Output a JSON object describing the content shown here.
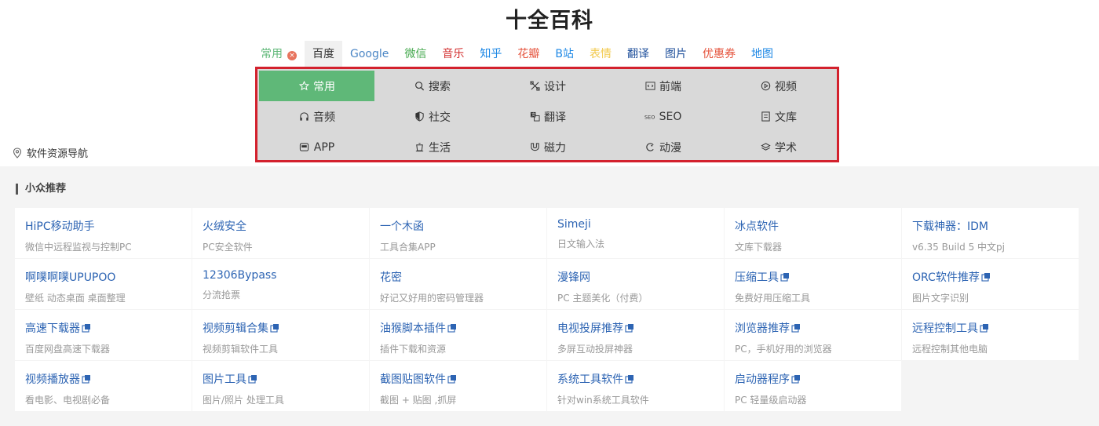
{
  "site": {
    "title": "十全百科"
  },
  "engines": [
    {
      "label": "常用",
      "color": "#5fb878",
      "closable": true
    },
    {
      "label": "百度",
      "color": "#333333",
      "active": true
    },
    {
      "label": "Google",
      "color": "#4b86c5"
    },
    {
      "label": "微信",
      "color": "#43a84c"
    },
    {
      "label": "音乐",
      "color": "#d32f2f"
    },
    {
      "label": "知乎",
      "color": "#1e88e5"
    },
    {
      "label": "花瓣",
      "color": "#e5533c"
    },
    {
      "label": "B站",
      "color": "#1e88e5"
    },
    {
      "label": "表情",
      "color": "#f2c94c"
    },
    {
      "label": "翻译",
      "color": "#1d4e9a"
    },
    {
      "label": "图片",
      "color": "#1d4e9a"
    },
    {
      "label": "优惠券",
      "color": "#e5533c"
    },
    {
      "label": "地图",
      "color": "#1e88e5"
    }
  ],
  "categories": [
    {
      "label": "常用",
      "icon": "star-icon",
      "active": true
    },
    {
      "label": "搜索",
      "icon": "search-icon"
    },
    {
      "label": "设计",
      "icon": "design-tools-icon"
    },
    {
      "label": "前端",
      "icon": "code-icon"
    },
    {
      "label": "视频",
      "icon": "play-icon"
    },
    {
      "label": "音频",
      "icon": "headphones-icon"
    },
    {
      "label": "社交",
      "icon": "shield-icon"
    },
    {
      "label": "翻译",
      "icon": "translate-icon"
    },
    {
      "label": "SEO",
      "icon": "seo-icon"
    },
    {
      "label": "文库",
      "icon": "document-icon"
    },
    {
      "label": "APP",
      "icon": "app-icon"
    },
    {
      "label": "生活",
      "icon": "cup-icon"
    },
    {
      "label": "磁力",
      "icon": "magnet-icon"
    },
    {
      "label": "动漫",
      "icon": "anime-icon"
    },
    {
      "label": "学术",
      "icon": "layers-icon"
    }
  ],
  "location": {
    "label": "软件资源导航",
    "icon": "location-pin-icon"
  },
  "section": {
    "title": "小众推荐"
  },
  "cards": [
    {
      "title": "HiPC移动助手",
      "desc": "微信中远程监视与控制PC",
      "external": false
    },
    {
      "title": "火绒安全",
      "desc": "PC安全软件",
      "external": false
    },
    {
      "title": "一个木函",
      "desc": "工具合集APP",
      "external": false
    },
    {
      "title": "Simeji",
      "desc": "日文输入法",
      "external": false
    },
    {
      "title": "冰点软件",
      "desc": "文库下载器",
      "external": false
    },
    {
      "title": "下载神器：IDM",
      "desc": "v6.35 Build 5 中文pj",
      "external": false
    },
    {
      "title": "啊噗啊噗UPUPOO",
      "desc": "壁纸 动态桌面 桌面整理",
      "external": false
    },
    {
      "title": "12306Bypass",
      "desc": "分流抢票",
      "external": false
    },
    {
      "title": "花密",
      "desc": "好记又好用的密码管理器",
      "external": false
    },
    {
      "title": "漫锋网",
      "desc": "PC 主题美化（付费）",
      "external": false
    },
    {
      "title": "压缩工具",
      "desc": "免费好用压缩工具",
      "external": true
    },
    {
      "title": "ORC软件推荐",
      "desc": "图片文字识别",
      "external": true
    },
    {
      "title": "高速下载器",
      "desc": "百度网盘高速下载器",
      "external": true
    },
    {
      "title": "视频剪辑合集",
      "desc": "视频剪辑软件工具",
      "external": true
    },
    {
      "title": "油猴脚本插件",
      "desc": "插件下载和资源",
      "external": true
    },
    {
      "title": "电视投屏推荐",
      "desc": "多屏互动投屏神器",
      "external": true
    },
    {
      "title": "浏览器推荐",
      "desc": "PC，手机好用的浏览器",
      "external": true
    },
    {
      "title": "远程控制工具",
      "desc": "远程控制其他电脑",
      "external": true
    },
    {
      "title": "视频播放器",
      "desc": "看电影、电视剧必备",
      "external": true
    },
    {
      "title": "图片工具",
      "desc": "图片/照片 处理工具",
      "external": true
    },
    {
      "title": "截图贴图软件",
      "desc": "截图 + 贴图 ,抓屏",
      "external": true
    },
    {
      "title": "系统工具软件",
      "desc": "针对win系统工具软件",
      "external": true
    },
    {
      "title": "启动器程序",
      "desc": "PC 轻量级启动器",
      "external": true
    }
  ],
  "colors": {
    "accent_green": "#5fb878",
    "highlight_border": "#d3212d",
    "link_blue": "#2d64b3"
  }
}
